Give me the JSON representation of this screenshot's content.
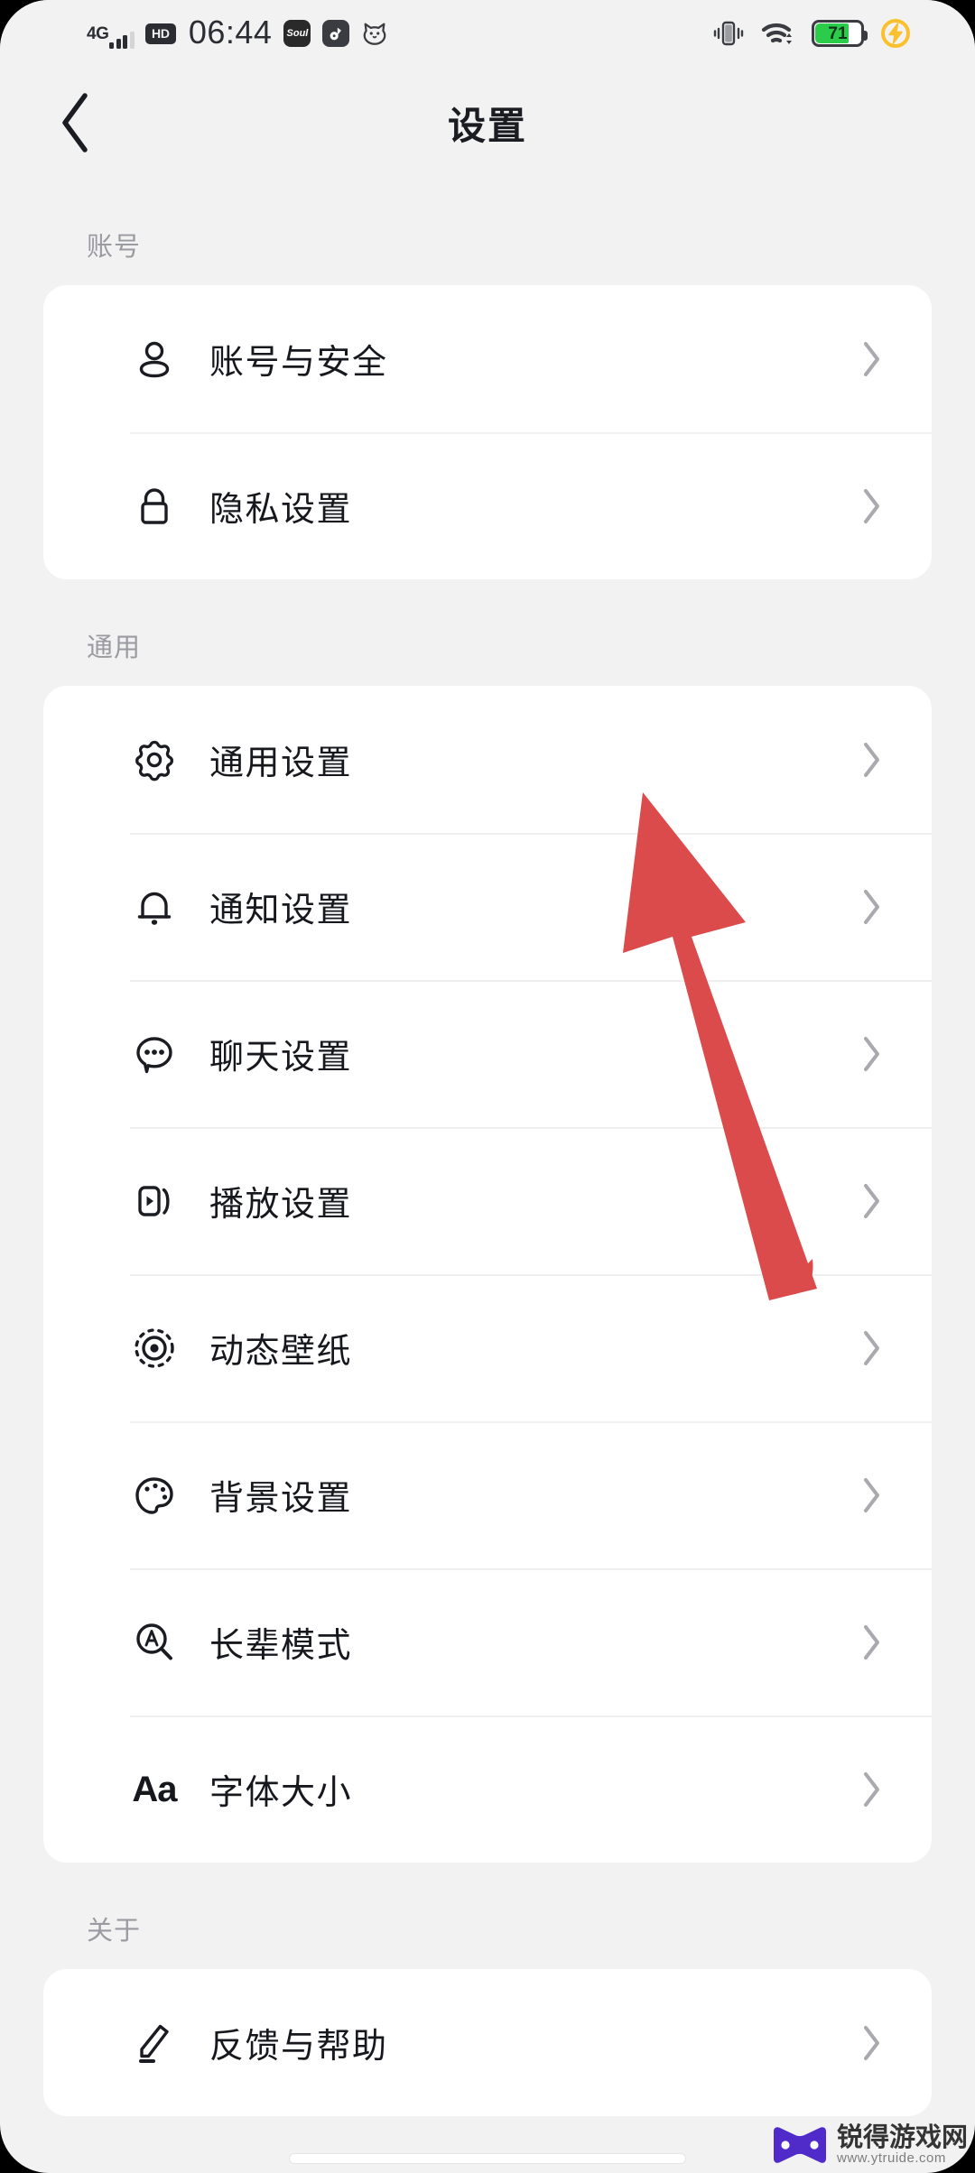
{
  "status_bar": {
    "network_type": "4G",
    "hd_badge": "HD",
    "time": "06:44",
    "app_icons": [
      {
        "name": "soul-app-icon",
        "label": "Soul"
      },
      {
        "name": "music-app-icon",
        "label": ""
      },
      {
        "name": "cat-app-icon",
        "label": ""
      }
    ],
    "vibrate_icon": "vibrate-icon",
    "wifi_icon": "wifi-icon",
    "battery_level": "71",
    "battery_color": "#2ACC4A",
    "charging_icon": "charging-bolt-icon",
    "charging_color": "#FBC02D"
  },
  "header": {
    "back_icon": "chevron-left-icon",
    "title": "设置"
  },
  "sections": [
    {
      "label": "账号",
      "items": [
        {
          "icon": "person-icon",
          "label": "账号与安全"
        },
        {
          "icon": "lock-icon",
          "label": "隐私设置"
        }
      ]
    },
    {
      "label": "通用",
      "items": [
        {
          "icon": "gear-icon",
          "label": "通用设置"
        },
        {
          "icon": "bell-icon",
          "label": "通知设置"
        },
        {
          "icon": "chat-bubble-icon",
          "label": "聊天设置"
        },
        {
          "icon": "play-video-icon",
          "label": "播放设置"
        },
        {
          "icon": "dynamic-wallpaper-icon",
          "label": "动态壁纸"
        },
        {
          "icon": "palette-icon",
          "label": "背景设置"
        },
        {
          "icon": "magnifier-a-icon",
          "label": "长辈模式"
        },
        {
          "icon": "font-size-aa-icon",
          "label": "字体大小"
        }
      ]
    },
    {
      "label": "关于",
      "items": [
        {
          "icon": "pencil-icon",
          "label": "反馈与帮助"
        }
      ]
    }
  ],
  "annotation": {
    "arrow_color": "#DB4B4B",
    "points_to": "通用设置"
  },
  "watermark": {
    "name": "锐得游戏网",
    "url": "www.ytruide.com",
    "logo_color": "#4B23C8"
  }
}
